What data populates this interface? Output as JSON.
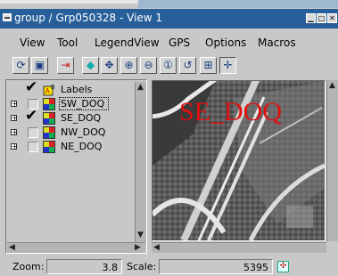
{
  "window": {
    "title": "group / Grp050328 - View 1",
    "controls": [
      "minimize-icon",
      "maximize-icon",
      "close-icon"
    ]
  },
  "menu": {
    "items": [
      "View",
      "Tool",
      "LegendView",
      "GPS",
      "Options",
      "Macros"
    ]
  },
  "toolbar": {
    "icons": [
      "redraw-icon",
      "full-extent-icon",
      "select-icon",
      "diamond-icon",
      "pan-icon",
      "zoom-in-icon",
      "zoom-out-icon",
      "zoom-1to1-icon",
      "zoom-previous-icon",
      "zoom-box-icon",
      "measure-icon"
    ]
  },
  "legend": {
    "labels_row": {
      "label": "Labels",
      "checked": true
    },
    "layers": [
      {
        "name": "SW_DOQ",
        "checked": false,
        "selected": true
      },
      {
        "name": "SE_DOQ",
        "checked": true,
        "selected": false
      },
      {
        "name": "NW_DOQ",
        "checked": false,
        "selected": false
      },
      {
        "name": "NE_DOQ",
        "checked": false,
        "selected": false
      }
    ]
  },
  "map": {
    "label": "SE_DOQ",
    "label_color": "#e01010"
  },
  "status": {
    "zoom_label": "Zoom:",
    "zoom_value": "3.8",
    "scale_label": "Scale:",
    "scale_value": "5395"
  }
}
